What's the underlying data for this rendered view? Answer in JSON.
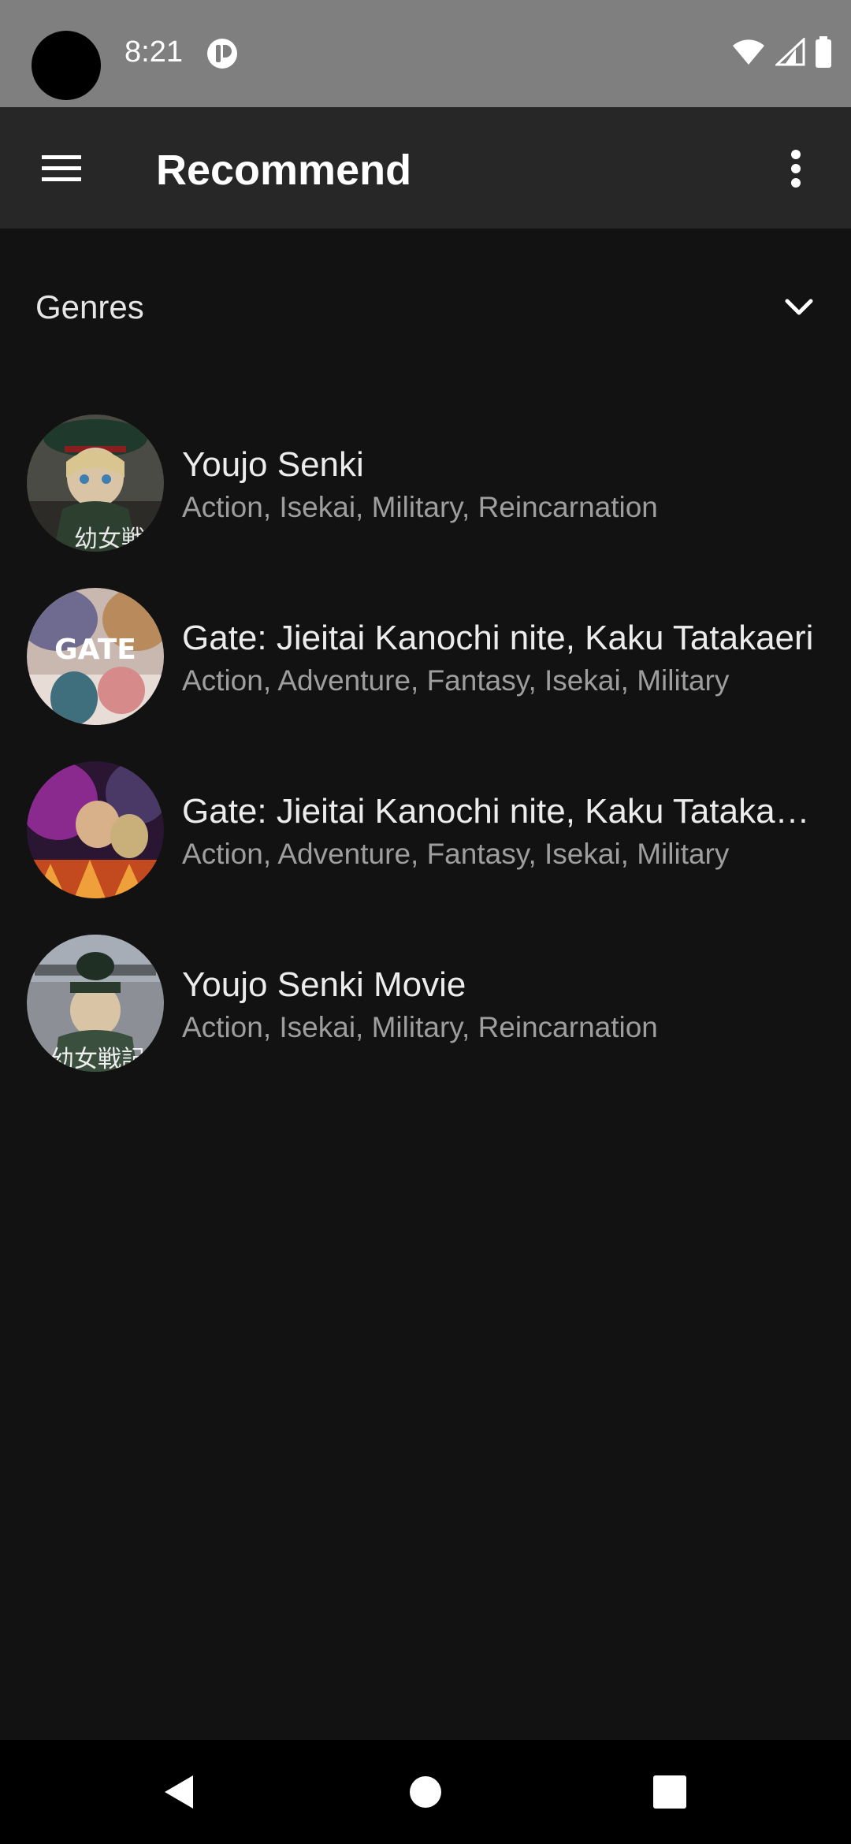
{
  "status_bar": {
    "time": "8:21",
    "app_icon": "notification-app-icon",
    "icons": [
      "wifi-icon",
      "cellular-signal-icon",
      "battery-icon"
    ]
  },
  "app_bar": {
    "menu_icon": "hamburger-menu-icon",
    "title": "Recommend",
    "overflow_icon": "more-vert-icon"
  },
  "genres_filter": {
    "label": "Genres",
    "icon": "chevron-down-icon"
  },
  "recommendations": [
    {
      "title": "Youjo Senki",
      "genres": "Action, Isekai, Military, Reincarnation",
      "thumbnail": "youjo-senki-poster"
    },
    {
      "title": "Gate: Jieitai Kanochi nite, Kaku Tatakaeri",
      "genres": "Action, Adventure, Fantasy, Isekai, Military",
      "thumbnail": "gate-poster",
      "thumbnail_text": "GATE"
    },
    {
      "title": "Gate: Jieitai Kanochi nite, Kaku Tatakaeri…",
      "genres": "Action, Adventure, Fantasy, Isekai, Military",
      "thumbnail": "gate-season-2-poster"
    },
    {
      "title": "Youjo Senki Movie",
      "genres": "Action, Isekai, Military, Reincarnation",
      "thumbnail": "youjo-senki-movie-poster"
    }
  ],
  "nav_bar": {
    "buttons": [
      "back-icon",
      "home-icon",
      "recents-icon"
    ]
  },
  "colors": {
    "background": "#121212",
    "app_bar": "#272727",
    "status_bar": "#7f7f7f",
    "primary_text": "#ececec",
    "secondary_text": "#9e9e9e"
  }
}
